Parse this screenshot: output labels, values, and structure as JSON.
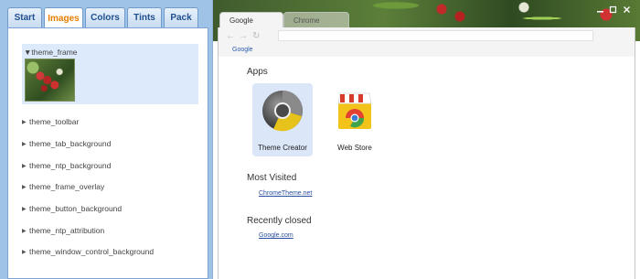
{
  "editor": {
    "tabs": [
      {
        "label": "Start",
        "active": false
      },
      {
        "label": "Images",
        "active": true
      },
      {
        "label": "Colors",
        "active": false
      },
      {
        "label": "Tints",
        "active": false
      },
      {
        "label": "Pack",
        "active": false
      }
    ],
    "selected_property": "theme_frame",
    "properties": [
      "theme_toolbar",
      "theme_tab_background",
      "theme_ntp_background",
      "theme_frame_overlay",
      "theme_button_background",
      "theme_ntp_attribution",
      "theme_window_control_background"
    ]
  },
  "browser": {
    "tabs": [
      {
        "label": "Google",
        "active": true
      },
      {
        "label": "Chrome",
        "active": false
      }
    ],
    "window_controls": [
      "minimize-icon",
      "maximize-icon",
      "close-icon"
    ],
    "bookmark_label": "Google",
    "ntp": {
      "apps_heading": "Apps",
      "apps": [
        {
          "label": "Theme Creator",
          "icon": "theme-creator-icon"
        },
        {
          "label": "Web Store",
          "icon": "web-store-icon"
        }
      ],
      "most_visited_heading": "Most Visited",
      "most_visited_link": "ChromeTheme.net",
      "recently_closed_heading": "Recently closed",
      "recently_closed_link": "Google.com"
    }
  },
  "colors": {
    "panel_bg": "#9fc3e6",
    "active_tab_text": "#e67e00",
    "tab_text": "#1f4f8f",
    "selection_bg": "#dceafb",
    "link": "#2a4fa0"
  }
}
